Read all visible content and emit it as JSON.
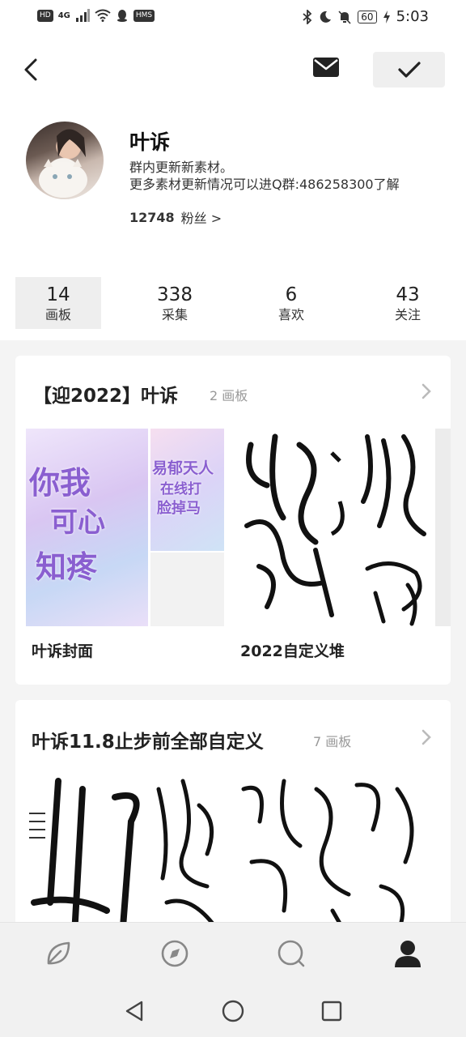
{
  "status_bar": {
    "network_badge": "HD",
    "signal_label": "4G",
    "extra_badge": "HMS",
    "battery": "60",
    "time": "5:03"
  },
  "header": {
    "back_icon": "chevron-left-icon",
    "mail_icon": "envelope-icon",
    "done_icon": "checkmark-icon"
  },
  "profile": {
    "name": "叶诉",
    "bio_line1": "群内更新新素材。",
    "bio_line2": "更多素材更新情况可以进Q群:486258300了解",
    "followers_count": "12748",
    "followers_label": "粉丝 >"
  },
  "stats": [
    {
      "count": "14",
      "label": "画板"
    },
    {
      "count": "338",
      "label": "采集"
    },
    {
      "count": "6",
      "label": "喜欢"
    },
    {
      "count": "43",
      "label": "关注"
    }
  ],
  "cards": [
    {
      "title": "【迎2022】叶诉",
      "count": "2 画板",
      "boards": [
        {
          "label": "叶诉封面",
          "cover_text_1": "你我",
          "cover_text_2": "可心",
          "cover_text_3": "知疼",
          "small_text_1": "易郁天人",
          "small_text_2": "在线打",
          "small_text_3": "脸掉马"
        },
        {
          "label": "2022自定义堆"
        }
      ]
    },
    {
      "title": "叶诉11.8止步前全部自定义",
      "count": "7 画板"
    }
  ],
  "bottom_nav": [
    {
      "icon": "leaf-icon"
    },
    {
      "icon": "compass-icon"
    },
    {
      "icon": "chat-bubble-icon"
    },
    {
      "icon": "profile-icon"
    }
  ],
  "system_nav": [
    {
      "icon": "back-triangle-icon"
    },
    {
      "icon": "home-circle-icon"
    },
    {
      "icon": "recents-square-icon"
    }
  ],
  "colors": {
    "background": "#f4f4f4",
    "card": "#ffffff",
    "active_tab": "#eeeeee",
    "muted_text": "#999999"
  }
}
